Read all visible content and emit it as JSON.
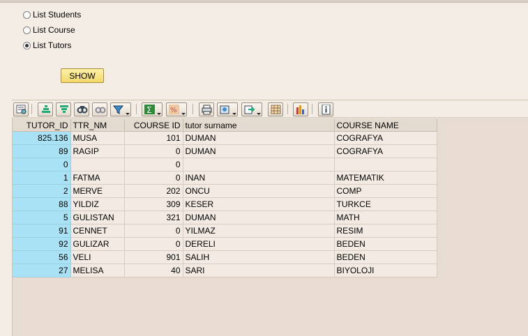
{
  "options": [
    {
      "label": "List Students",
      "checked": false
    },
    {
      "label": "List Course",
      "checked": false
    },
    {
      "label": "List Tutors",
      "checked": true
    }
  ],
  "show_button": "SHOW",
  "toolbar_icons": [
    "details-icon",
    "sort-ascending-icon",
    "sort-descending-icon",
    "find-icon",
    "find-next-icon",
    "filter-icon",
    "sum-icon",
    "subtotal-icon",
    "print-icon",
    "views-icon",
    "export-icon",
    "layout-icon",
    "graphic-icon",
    "information-icon"
  ],
  "table": {
    "columns": [
      "TUTOR_ID",
      "TTR_NM",
      "COURSE ID",
      "tutor surname",
      "COURSE NAME"
    ],
    "rows": [
      [
        "825.136",
        "MUSA",
        "101",
        "DUMAN",
        "COGRAFYA"
      ],
      [
        "89",
        "RAGIP",
        "0",
        "DUMAN",
        "COGRAFYA"
      ],
      [
        "0",
        "",
        "0",
        "",
        ""
      ],
      [
        "1",
        "FATMA",
        "0",
        "INAN",
        "MATEMATIK"
      ],
      [
        "2",
        "MERVE",
        "202",
        "ONCU",
        "COMP"
      ],
      [
        "88",
        "YILDIZ",
        "309",
        "KESER",
        "TURKCE"
      ],
      [
        "5",
        "GULISTAN",
        "321",
        "DUMAN",
        "MATH"
      ],
      [
        "91",
        "CENNET",
        "0",
        "YILMAZ",
        "RESIM"
      ],
      [
        "92",
        "GULIZAR",
        "0",
        "DERELI",
        "BEDEN"
      ],
      [
        "56",
        "VELI",
        "901",
        "SALIH",
        "BEDEN"
      ],
      [
        "27",
        "MELISA",
        "40",
        "SARI",
        "BIYOLOJI"
      ]
    ]
  }
}
